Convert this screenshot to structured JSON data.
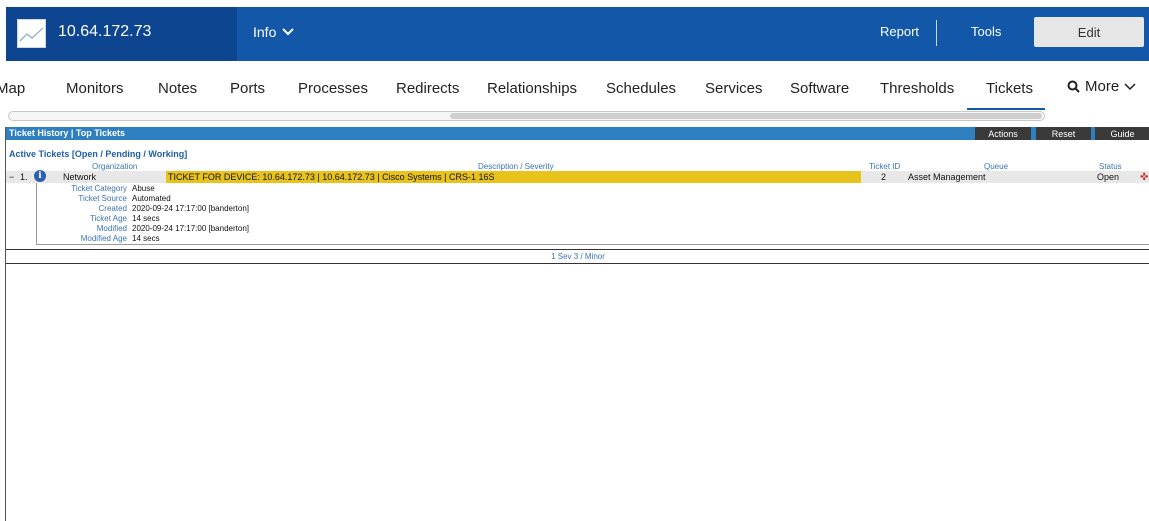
{
  "header": {
    "device_ip": "10.64.172.73",
    "info_label": "Info",
    "report_label": "Report",
    "tools_label": "Tools",
    "edit_label": "Edit"
  },
  "tabs": {
    "items": [
      "Map",
      "Monitors",
      "Notes",
      "Ports",
      "Processes",
      "Redirects",
      "Relationships",
      "Schedules",
      "Services",
      "Software",
      "Thresholds",
      "Tickets"
    ],
    "active": "Tickets",
    "more_label": "More"
  },
  "panel": {
    "title": "Ticket History | Top Tickets",
    "actions_label": "Actions",
    "reset_label": "Reset",
    "guide_label": "Guide",
    "section_title": "Active Tickets [Open / Pending / Working]",
    "columns": {
      "organization": "Organization",
      "description": "Description / Severity",
      "ticket_id": "Ticket ID",
      "queue": "Queue",
      "status": "Status"
    },
    "ticket": {
      "row_number": "1.",
      "organization": "Network",
      "description": "TICKET FOR DEVICE: 10.64.172.73 | 10.64.172.73 | Cisco Systems | CRS-1 16S",
      "ticket_id": "2",
      "queue": "Asset Management",
      "status": "Open",
      "details": {
        "category_label": "Ticket Category",
        "category_value": "Abuse",
        "source_label": "Ticket Source",
        "source_value": "Automated",
        "created_label": "Created",
        "created_value": "2020-09-24 17:17:00 [banderton]",
        "age_label": "Ticket Age",
        "age_value": "14 secs",
        "modified_label": "Modified",
        "modified_value": "2020-09-24 17:17:00 [banderton]",
        "modified_age_label": "Modified Age",
        "modified_age_value": "14 secs"
      }
    },
    "footer": "1 Sev 3 / Minor"
  },
  "colors": {
    "topbar": "#1257a8",
    "device_box": "#0d4590",
    "panel_header": "#2f80c0",
    "severity_minor": "#e7c31c"
  }
}
